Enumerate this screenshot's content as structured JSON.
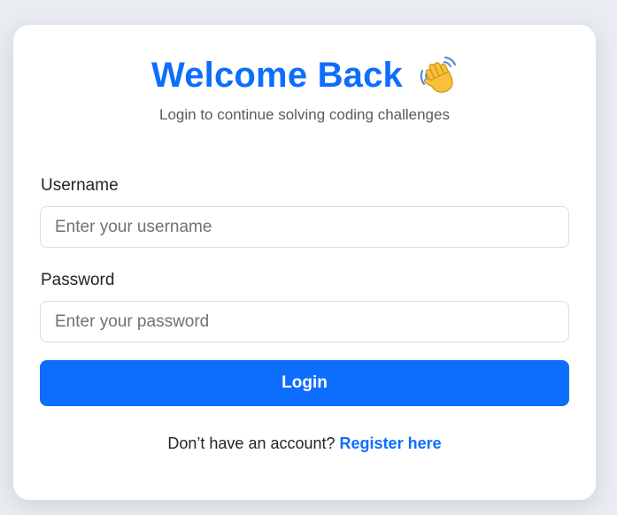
{
  "header": {
    "title": "Welcome Back",
    "icon": "waving-hand-icon",
    "subtitle": "Login to continue solving coding challenges"
  },
  "form": {
    "username": {
      "label": "Username",
      "placeholder": "Enter your username",
      "value": ""
    },
    "password": {
      "label": "Password",
      "placeholder": "Enter your password",
      "value": ""
    },
    "submit_label": "Login"
  },
  "footer": {
    "prompt": "Don’t have an account?",
    "link_label": "Register here"
  },
  "colors": {
    "accent": "#0d6efd",
    "background": "#e9ecf1",
    "card": "#ffffff"
  }
}
